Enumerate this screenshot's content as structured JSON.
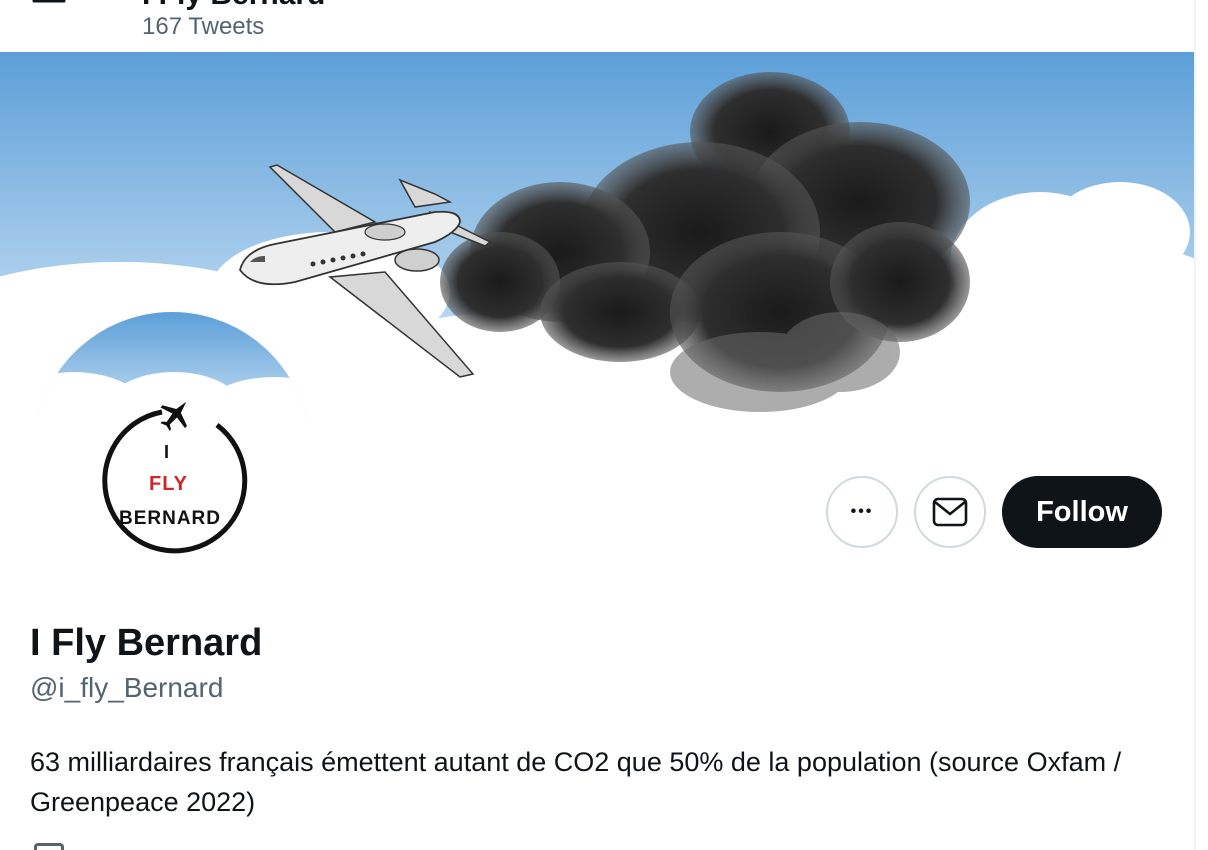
{
  "header": {
    "name_partial": "I Fly Bernard",
    "tweet_count": "167 Tweets"
  },
  "profile": {
    "display_name": "I Fly Bernard",
    "handle": "@i_fly_Bernard",
    "bio": "63 milliardaires français émettent autant de CO2 que 50% de la population (source Oxfam / Greenpeace 2022)"
  },
  "avatar": {
    "line1": "I",
    "line2": "FLY",
    "line3": "BERNARD"
  },
  "actions": {
    "more_label": "•••",
    "follow_label": "Follow"
  },
  "colors": {
    "sky_top": "#5c9fd8",
    "sky_bottom": "#d4e7f6",
    "smoke": "#2a2a2a",
    "follow_bg": "#0f1419",
    "avatar_red": "#d0262a",
    "secondary_text": "#536471"
  }
}
